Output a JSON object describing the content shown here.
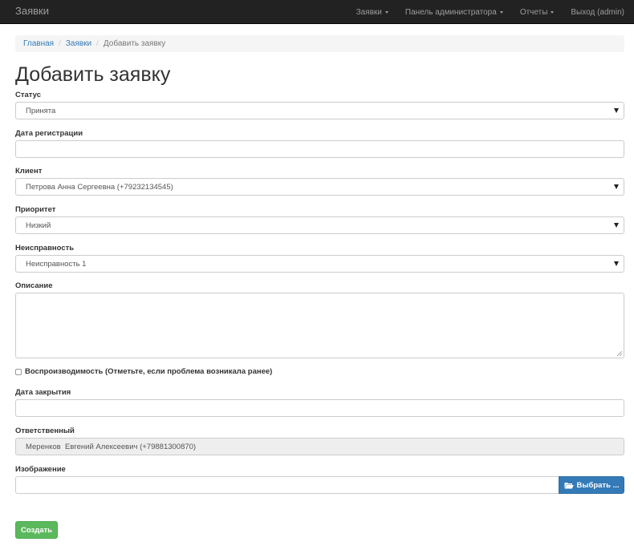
{
  "navbar": {
    "brand": "Заявки",
    "items": [
      {
        "label": "Заявки",
        "dropdown": true
      },
      {
        "label": "Панель администратора",
        "dropdown": true
      },
      {
        "label": "Отчеты",
        "dropdown": true
      },
      {
        "label": "Выход (admin)",
        "dropdown": false
      }
    ]
  },
  "breadcrumb": {
    "items": [
      "Главная",
      "Заявки",
      "Добавить заявку"
    ]
  },
  "page": {
    "title": "Добавить заявку"
  },
  "form": {
    "status": {
      "label": "Статус",
      "value": "Принята"
    },
    "reg_date": {
      "label": "Дата регистрации",
      "value": ""
    },
    "client": {
      "label": "Клиент",
      "value": "Петрова Анна Сергеевна (+79232134545)"
    },
    "priority": {
      "label": "Приоритет",
      "value": "Низкий"
    },
    "fault": {
      "label": "Неисправность",
      "value": "Неисправность 1"
    },
    "description": {
      "label": "Описание",
      "value": ""
    },
    "reproducible": {
      "label": "Воспроизводимость (Отметьте, если проблема возникала ранее)",
      "checked": false
    },
    "close_date": {
      "label": "Дата закрытия",
      "value": ""
    },
    "responsible": {
      "label": "Ответственный",
      "value": "Меренков  Евгений Алексеевич (+79881300870)"
    },
    "image": {
      "label": "Изображение",
      "browse_label": "Выбрать ..."
    },
    "submit_label": "Создать"
  },
  "colors": {
    "navbar": "#222222",
    "link": "#337ab7",
    "primary": "#337ab7",
    "success": "#5cb85c"
  },
  "icons": {
    "browse": "folder-open-icon",
    "select": "triangle-down-icon"
  }
}
